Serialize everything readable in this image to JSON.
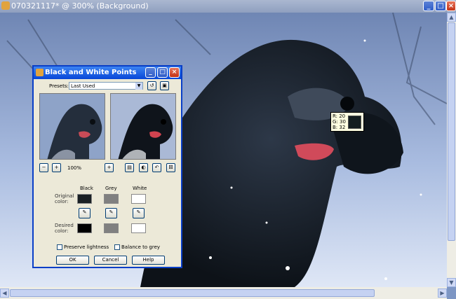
{
  "document": {
    "title": "070321117* @ 300% (Background)"
  },
  "pixel_readout": {
    "r": "R: 20",
    "g": "G: 30",
    "b": "B: 32",
    "color": "#141e20"
  },
  "dialog": {
    "title": "Black and White Points",
    "presets_label": "Presets:",
    "preset_value": "Last Used",
    "zoom": "100%",
    "columns": {
      "black": "Black",
      "grey": "Grey",
      "white": "White"
    },
    "original_label": "Original\ncolor:",
    "desired_label": "Desired\ncolor:",
    "original_colors": {
      "black": "#1a2024",
      "grey": "#808080",
      "white": "#ffffff"
    },
    "desired_colors": {
      "black": "#000000",
      "grey": "#808080",
      "white": "#ffffff"
    },
    "preserve_lightness": "Preserve lightness",
    "balance_to_grey": "Balance to grey",
    "ok": "OK",
    "cancel": "Cancel",
    "help": "Help"
  },
  "colors": {
    "titlebar_active": "#0a3fc7",
    "dialog_bg": "#ece9d8"
  }
}
